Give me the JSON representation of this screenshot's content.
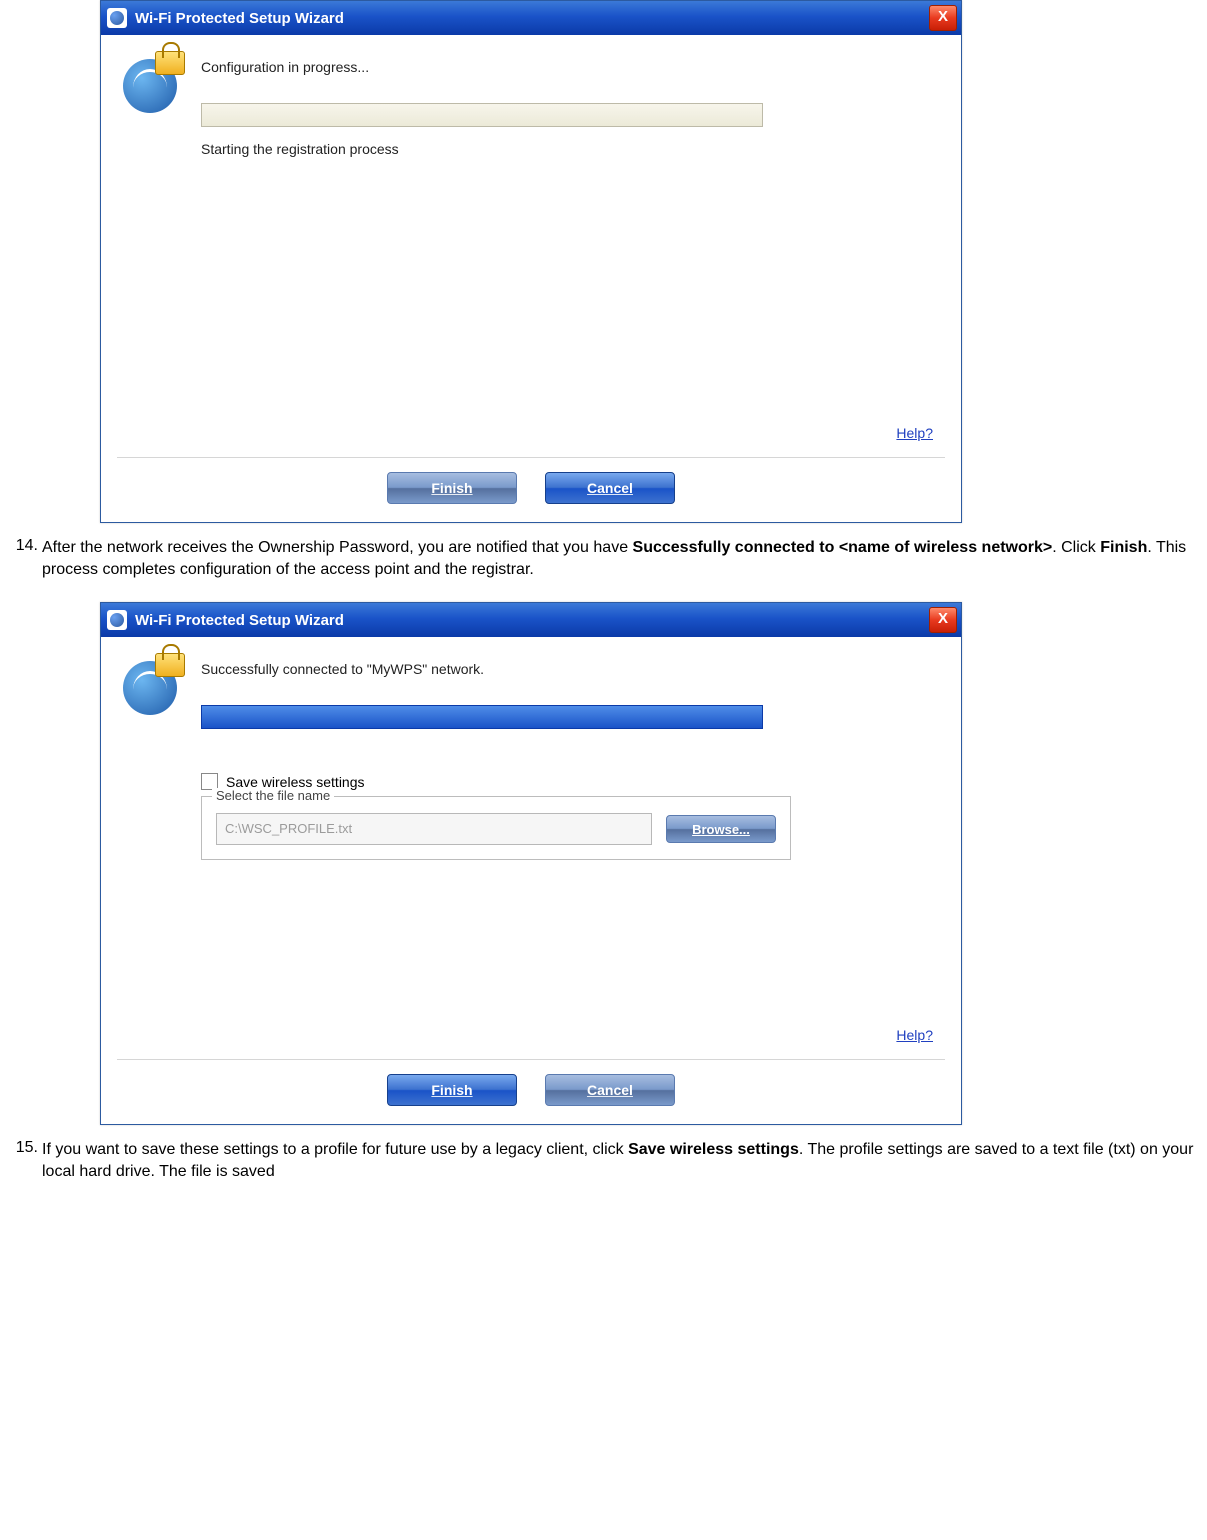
{
  "dialog1": {
    "title": "Wi-Fi Protected Setup Wizard",
    "message": "Configuration in progress...",
    "status": "Starting the registration process",
    "help_label": "Help?",
    "finish_label": "Finish",
    "cancel_label": "Cancel"
  },
  "step14": {
    "num": "14.",
    "text_a": "After the network receives the Ownership Password, you are notified that you have ",
    "bold_a": "Successfully connected to <name of wireless network>",
    "text_b": ". Click ",
    "bold_b": "Finish",
    "text_c": ". This process completes configuration of the access point and the registrar."
  },
  "dialog2": {
    "title": "Wi-Fi Protected Setup Wizard",
    "message": "Successfully connected to \"MyWPS\" network.",
    "save_checkbox_label": "Save wireless settings",
    "fieldset_legend": "Select the file name",
    "file_path": "C:\\WSC_PROFILE.txt",
    "browse_label": "Browse...",
    "help_label": "Help?",
    "finish_label": "Finish",
    "cancel_label": "Cancel"
  },
  "step15": {
    "num": "15.",
    "text_a": "If you want to save these settings to a profile for future use by a legacy client, click ",
    "bold_a": "Save wireless settings",
    "text_b": ". The profile settings are saved to a text file (txt) on your local hard drive. The file is saved"
  }
}
